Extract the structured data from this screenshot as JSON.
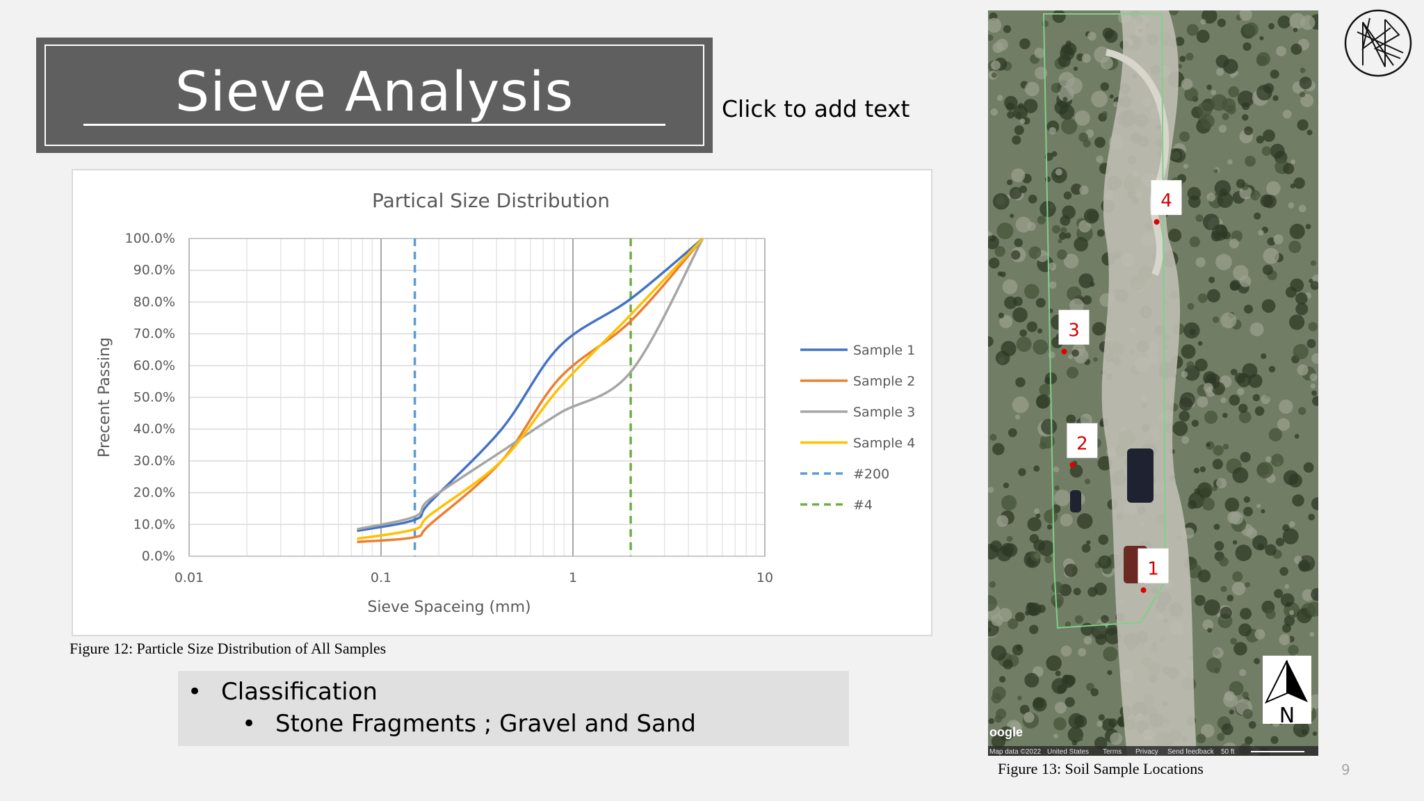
{
  "slide": {
    "title": "Sieve Analysis",
    "placeholder": "Click to add text",
    "page_number": "9"
  },
  "captions": {
    "figure12": "Figure 12: Particle Size Distribution of All Samples",
    "figure13": "Figure 13: Soil Sample Locations"
  },
  "bullets": {
    "level1": "Classification",
    "level2": "Stone Fragments ; Gravel and Sand"
  },
  "map": {
    "markers": [
      {
        "label": "4",
        "x": 0.54,
        "y": 0.252
      },
      {
        "label": "3",
        "x": 0.26,
        "y": 0.426
      },
      {
        "label": "2",
        "x": 0.285,
        "y": 0.578
      },
      {
        "label": "1",
        "x": 0.5,
        "y": 0.746
      }
    ],
    "north_label": "N",
    "google_label": "oogle",
    "footer_items": [
      "Map data ©2022",
      "United States",
      "Terms",
      "Privacy",
      "Send feedback",
      "50 ft"
    ]
  },
  "chart_data": {
    "type": "line",
    "title": "Partical Size Distribution",
    "xlabel": "Sieve Spaceing (mm)",
    "ylabel": "Precent Passing",
    "x_scale": "log",
    "xlim": [
      0.01,
      10
    ],
    "ylim": [
      0,
      100
    ],
    "x_ticks": [
      {
        "value": 0.01,
        "label": "0.01"
      },
      {
        "value": 0.1,
        "label": "0.1"
      },
      {
        "value": 1,
        "label": "1"
      },
      {
        "value": 10,
        "label": "10"
      }
    ],
    "y_ticks": [
      {
        "value": 0,
        "label": "0.0%"
      },
      {
        "value": 10,
        "label": "10.0%"
      },
      {
        "value": 20,
        "label": "20.0%"
      },
      {
        "value": 30,
        "label": "30.0%"
      },
      {
        "value": 40,
        "label": "40.0%"
      },
      {
        "value": 50,
        "label": "50.0%"
      },
      {
        "value": 60,
        "label": "60.0%"
      },
      {
        "value": 70,
        "label": "70.0%"
      },
      {
        "value": 80,
        "label": "80.0%"
      },
      {
        "value": 90,
        "label": "90.0%"
      },
      {
        "value": 100,
        "label": "100.0%"
      }
    ],
    "grid": true,
    "legend_position": "right",
    "series": [
      {
        "name": "Sample 1",
        "color": "#4472c4",
        "points": [
          [
            0.075,
            8
          ],
          [
            0.15,
            11.5
          ],
          [
            0.18,
            17
          ],
          [
            0.425,
            40
          ],
          [
            0.85,
            66
          ],
          [
            2,
            81
          ],
          [
            4.75,
            100
          ]
        ]
      },
      {
        "name": "Sample 2",
        "color": "#ed7d31",
        "points": [
          [
            0.075,
            4.5
          ],
          [
            0.15,
            6
          ],
          [
            0.18,
            10
          ],
          [
            0.425,
            30
          ],
          [
            0.85,
            56
          ],
          [
            2,
            74
          ],
          [
            4.75,
            100
          ]
        ]
      },
      {
        "name": "Sample 3",
        "color": "#a5a5a5",
        "points": [
          [
            0.075,
            8.5
          ],
          [
            0.15,
            12.5
          ],
          [
            0.18,
            18
          ],
          [
            0.425,
            33
          ],
          [
            0.85,
            45
          ],
          [
            2,
            58
          ],
          [
            4.75,
            100
          ]
        ]
      },
      {
        "name": "Sample 4",
        "color": "#ffc000",
        "points": [
          [
            0.075,
            5.5
          ],
          [
            0.15,
            8.5
          ],
          [
            0.18,
            13
          ],
          [
            0.425,
            30
          ],
          [
            0.85,
            53
          ],
          [
            2,
            76
          ],
          [
            4.75,
            100
          ]
        ]
      }
    ],
    "reference_lines": [
      {
        "name": "#200",
        "x": 0.15,
        "color": "#5b9bd5"
      },
      {
        "name": "#4",
        "x": 2,
        "color": "#70ad47"
      }
    ]
  }
}
